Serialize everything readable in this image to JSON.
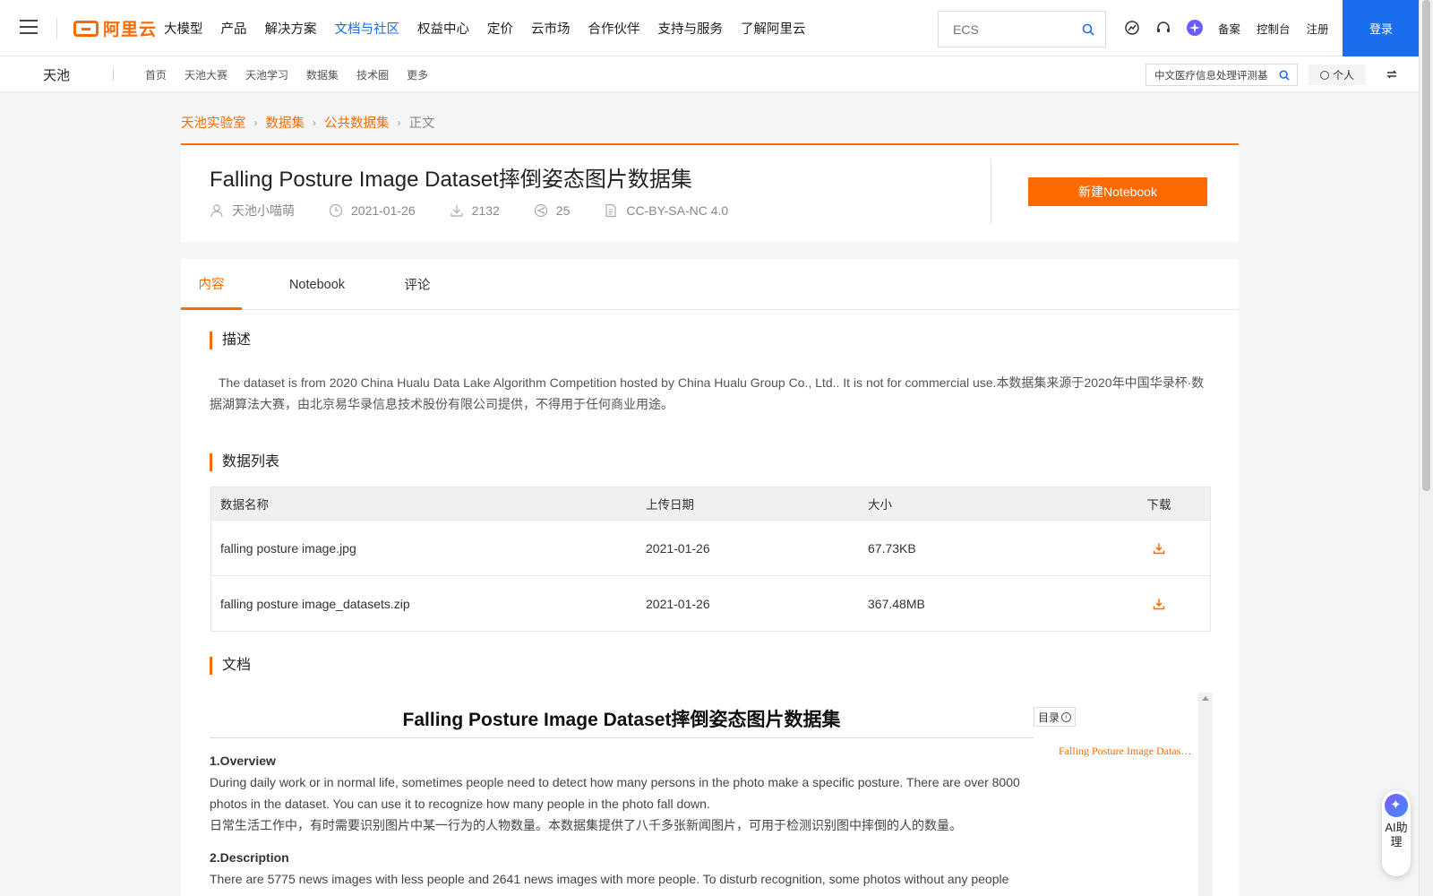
{
  "topnav": {
    "logo": "阿里云",
    "items": [
      "大模型",
      "产品",
      "解决方案",
      "文档与社区",
      "权益中心",
      "定价",
      "云市场",
      "合作伙伴",
      "支持与服务",
      "了解阿里云"
    ],
    "active_item": "文档与社区",
    "search_placeholder": "ECS",
    "icons": [
      "dashboard-icon",
      "headset-icon",
      "ai-sparkle-icon"
    ],
    "links": [
      "备案",
      "控制台",
      "注册"
    ],
    "login": "登录"
  },
  "subnav": {
    "brand": "天池",
    "links": [
      "首页",
      "天池大赛",
      "天池学习",
      "数据集",
      "技术圈",
      "更多"
    ],
    "search_value": "中文医疗信息处理评测基",
    "personal": "个人"
  },
  "breadcrumb": [
    "天池实验室",
    "数据集",
    "公共数据集"
  ],
  "breadcrumb_current": "正文",
  "dataset": {
    "title": "Falling Posture Image Dataset摔倒姿态图片数据集",
    "author": "天池小喵萌",
    "date": "2021-01-26",
    "downloads": "2132",
    "shares": "25",
    "license": "CC-BY-SA-NC 4.0",
    "new_notebook": "新建Notebook"
  },
  "tabs": [
    "内容",
    "Notebook",
    "评论"
  ],
  "active_tab": "内容",
  "sections": {
    "description_title": "描述",
    "description": "The dataset is from 2020 China Hualu Data Lake Algorithm Competition hosted by China Hualu Group Co., Ltd.. It is not for commercial use.本数据集来源于2020年中国华录杯·数据湖算法大赛，由北京易华录信息技术股份有限公司提供，不得用于任何商业用途。",
    "datalist_title": "数据列表",
    "docs_title": "文档"
  },
  "table": {
    "headers": [
      "数据名称",
      "上传日期",
      "大小",
      "下载"
    ],
    "rows": [
      {
        "name": "falling posture image.jpg",
        "date": "2021-01-26",
        "size": "67.73KB"
      },
      {
        "name": "falling posture image_datasets.zip",
        "date": "2021-01-26",
        "size": "367.48MB"
      }
    ]
  },
  "doc": {
    "title": "Falling Posture Image Dataset摔倒姿态图片数据集",
    "toc_label": "目录",
    "toc_link": "Falling Posture Image Dataset摔倒姿态图片数据集",
    "overview_heading": "1.Overview",
    "overview_en": "During daily work or in normal life, sometimes people need to detect how many persons in the photo make a specific posture. There are over 8000 photos in the dataset. You can use it to recognize how many people in the photo fall down.",
    "overview_zh": "日常生活工作中，有时需要识别图片中某一行为的人物数量。本数据集提供了八千多张新闻图片，可用于检测识别图中摔倒的人的数量。",
    "description_heading": "2.Description",
    "description_en": "There are 5775 news images with less people and 2641 news images with more people. To disturb recognition, some photos without any people"
  },
  "ai_widget": "AI助理",
  "colors": {
    "accent": "#ff6a00",
    "brand_blue": "#1a6eed",
    "page_bg": "#f5f5f6"
  }
}
